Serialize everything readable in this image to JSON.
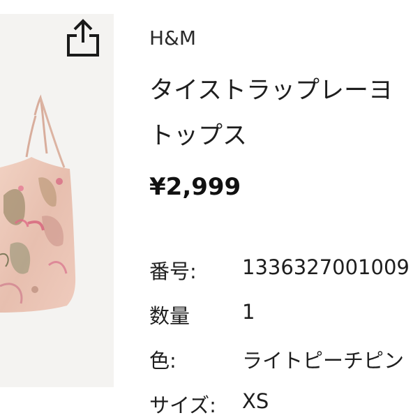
{
  "product": {
    "brand": "H&M",
    "title_line1": "タイストラップレーヨ",
    "title_line2": "トップス",
    "price": "¥2,999"
  },
  "specs": [
    {
      "label": "番号:",
      "value": "1336327001009"
    },
    {
      "label": "数量",
      "value": "1"
    },
    {
      "label": "色:",
      "value": "ライトピーチピン"
    },
    {
      "label": "サイズ:",
      "value": "XS"
    }
  ],
  "icons": {
    "share": "share-icon"
  },
  "colors": {
    "text": "#1e1e1e",
    "price": "#111111",
    "image_background": "#f4f3f1"
  }
}
